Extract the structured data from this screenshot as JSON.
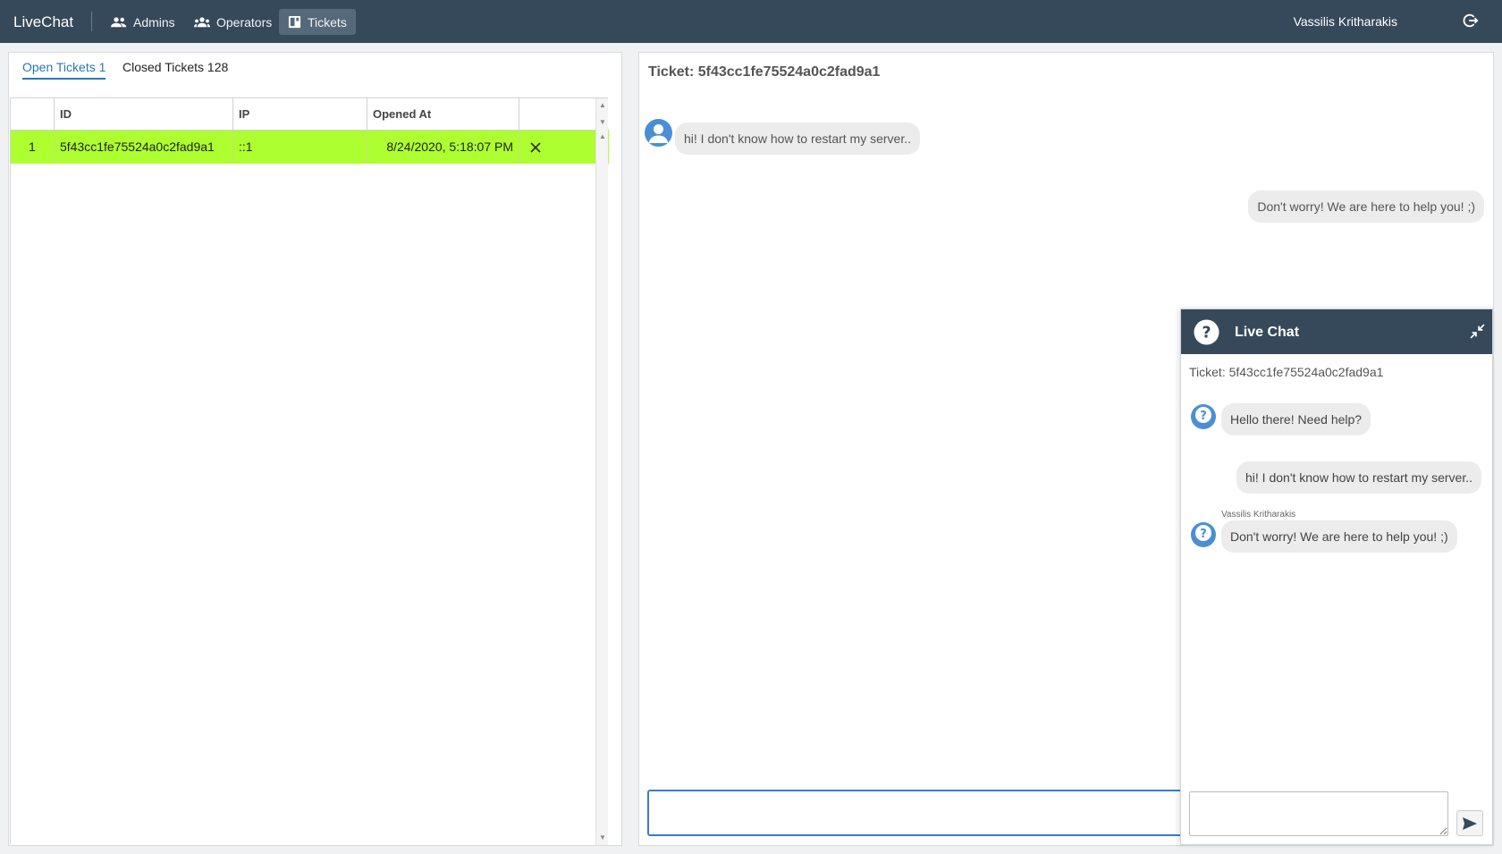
{
  "app": {
    "brand": "LiveChat",
    "user": "Vassilis Kritharakis"
  },
  "nav": {
    "items": [
      {
        "label": "Admins",
        "icon": "people-icon"
      },
      {
        "label": "Operators",
        "icon": "group-icon"
      },
      {
        "label": "Tickets",
        "icon": "ticket-icon",
        "active": true
      }
    ]
  },
  "tabs": {
    "open": "Open Tickets 1",
    "closed": "Closed Tickets 128"
  },
  "grid": {
    "columns": [
      "",
      "ID",
      "IP",
      "Opened At",
      ""
    ],
    "rows": [
      {
        "index": "1",
        "id": "5f43cc1fe75524a0c2fad9a1",
        "ip": "::1",
        "opened_at": "8/24/2020, 5:18:07 PM"
      }
    ],
    "row_color": "#adff2f"
  },
  "conversation": {
    "title": "Ticket: 5f43cc1fe75524a0c2fad9a1",
    "messages": [
      {
        "from": "visitor",
        "text": "hi! I don't know how to restart my server.."
      },
      {
        "from": "operator",
        "text": "Don't worry! We are here to help you! ;)"
      }
    ],
    "reply_value": ""
  },
  "widget": {
    "title": "Live Chat",
    "ticket": "Ticket: 5f43cc1fe75524a0c2fad9a1",
    "messages": [
      {
        "from": "bot",
        "text": "Hello there! Need help?"
      },
      {
        "from": "visitor",
        "text": "hi! I don't know how to restart my server.."
      },
      {
        "from": "operator",
        "sender": "Vassilis Kritharakis",
        "text": "Don't worry! We are here to help you! ;)"
      }
    ],
    "input_value": ""
  },
  "colors": {
    "topbar": "#36495a",
    "accent": "#2978b5",
    "row_highlight": "#adff2f",
    "avatar_blue": "#4a8fd6"
  }
}
